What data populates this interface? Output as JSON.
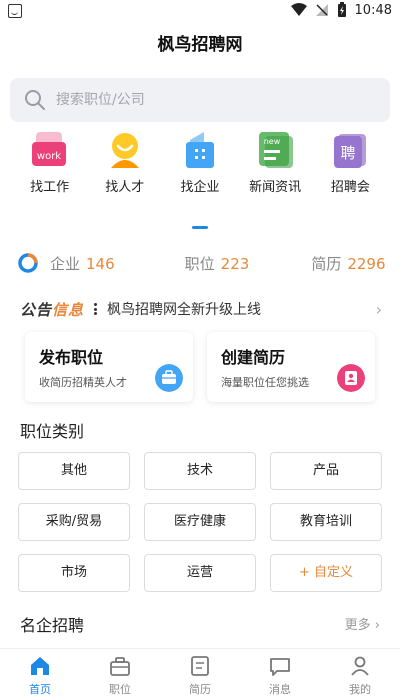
{
  "status_bar": {
    "time": "10:48"
  },
  "header": {
    "title": "枫鸟招聘网"
  },
  "search": {
    "placeholder": "搜索职位/公司"
  },
  "nav": [
    {
      "label": "找工作",
      "icon": "work-icon",
      "icon_text": "work",
      "color": "#f06292"
    },
    {
      "label": "找人才",
      "icon": "talent-icon",
      "color": "#ffb300"
    },
    {
      "label": "找企业",
      "icon": "company-icon",
      "color": "#42a5f5"
    },
    {
      "label": "新闻资讯",
      "icon": "news-icon",
      "icon_text": "new",
      "color": "#4caf50"
    },
    {
      "label": "招聘会",
      "icon": "job-fair-icon",
      "icon_text": "聘",
      "color": "#9c6ade"
    }
  ],
  "stats": [
    {
      "label": "企业",
      "value": "146"
    },
    {
      "label": "职位",
      "value": "223"
    },
    {
      "label": "简历",
      "value": "2296"
    }
  ],
  "notice": {
    "logo_a": "公告",
    "logo_b": "信息",
    "text": "枫鸟招聘网全新升级上线"
  },
  "cards": [
    {
      "title": "发布职位",
      "subtitle": "收简历招精英人才",
      "icon": "briefcase-icon",
      "color": "#42a5f5"
    },
    {
      "title": "创建简历",
      "subtitle": "海量职位任您挑选",
      "icon": "resume-icon",
      "color": "#ec407a"
    }
  ],
  "categories": {
    "title": "职位类别",
    "items": [
      "其他",
      "技术",
      "产品",
      "采购/贸易",
      "医疗健康",
      "教育培训",
      "市场",
      "运营",
      "+ 自定义"
    ]
  },
  "famous": {
    "title": "名企招聘",
    "more": "更多"
  },
  "tabs": [
    {
      "label": "首页",
      "icon": "home-icon",
      "active": true
    },
    {
      "label": "职位",
      "icon": "briefcase-icon",
      "active": false
    },
    {
      "label": "简历",
      "icon": "resume-icon",
      "active": false
    },
    {
      "label": "消息",
      "icon": "message-icon",
      "active": false
    },
    {
      "label": "我的",
      "icon": "user-icon",
      "active": false
    }
  ],
  "colors": {
    "accent": "#1e88e5",
    "orange": "#e8883a"
  }
}
